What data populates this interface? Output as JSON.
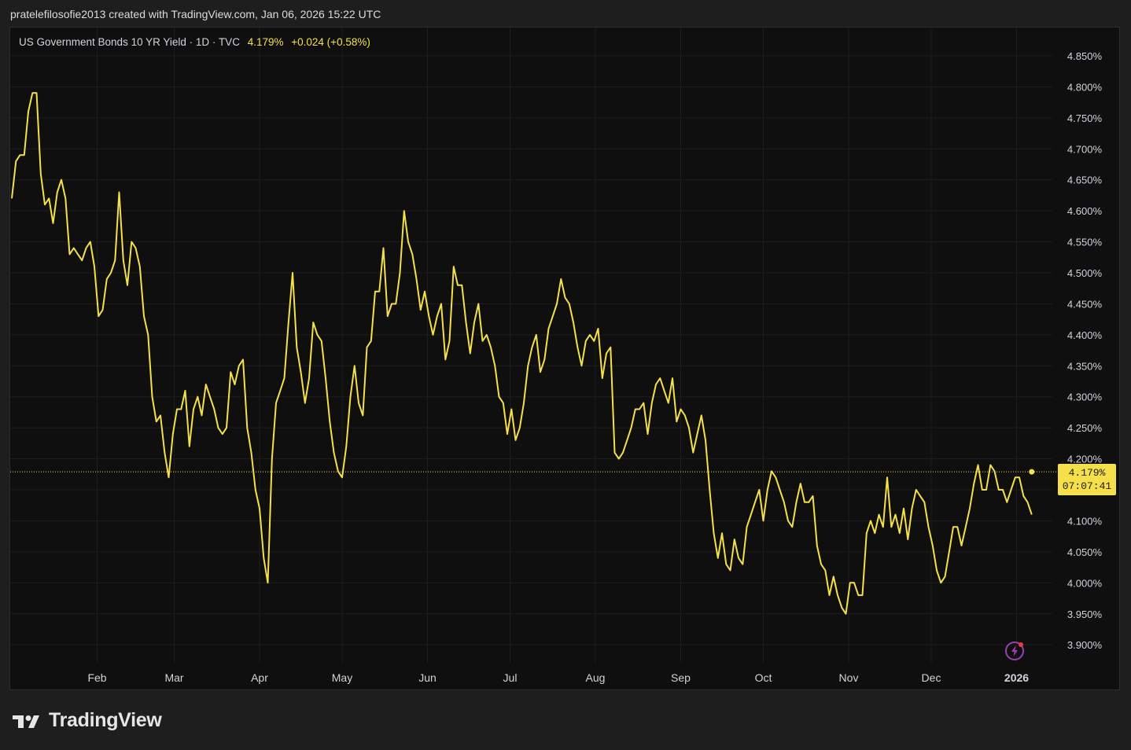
{
  "caption": "pratelefilosofie2013 created with TradingView.com, Jan 06, 2026 15:22 UTC",
  "legend": {
    "name": "US Government Bonds 10 YR Yield",
    "interval": "1D",
    "source": "TVC",
    "last": "4.179%",
    "change": "+0.024 (+0.58%)"
  },
  "price_tag": {
    "value": "4.179%",
    "countdown": "07:07:41"
  },
  "brand": {
    "name": "TradingView"
  },
  "colors": {
    "line": "#f5e049",
    "background": "#0f0f0f",
    "grid": "#1e1e1e",
    "text": "#d1d4dc"
  },
  "icons": [
    "tradingview-logo-icon",
    "bolt-icon"
  ],
  "chart_data": {
    "type": "line",
    "ylim": [
      3.86,
      4.88
    ],
    "yticks": [
      "4.850%",
      "4.800%",
      "4.750%",
      "4.700%",
      "4.650%",
      "4.600%",
      "4.550%",
      "4.500%",
      "4.450%",
      "4.400%",
      "4.350%",
      "4.300%",
      "4.250%",
      "4.200%",
      "4.150%",
      "4.100%",
      "4.050%",
      "4.000%",
      "3.950%",
      "3.900%"
    ],
    "xticks": [
      "Feb",
      "Mar",
      "Apr",
      "May",
      "Jun",
      "Jul",
      "Aug",
      "Sep",
      "Oct",
      "Nov",
      "Dec",
      "2026"
    ],
    "xtick_values": [
      31,
      59,
      90,
      120,
      151,
      181,
      212,
      243,
      273,
      304,
      334,
      365
    ],
    "x_days": [
      0,
      1.5,
      3,
      4.5,
      6,
      7.5,
      9,
      10.5,
      12,
      13.5,
      15,
      16.5,
      18,
      19.5,
      21,
      22.5,
      24,
      25.5,
      27,
      28.5,
      30,
      31.5,
      33,
      34.5,
      36,
      37.5,
      39,
      40.5,
      42,
      43.5,
      45,
      46.5,
      48,
      49.5,
      51,
      52.5,
      54,
      55.5,
      57,
      58.5,
      60,
      61.5,
      63,
      64.5,
      66,
      67.5,
      69,
      70.5,
      72,
      73.5,
      75,
      76.5,
      78,
      79.5,
      81,
      82.5,
      84,
      85.5,
      87,
      88.5,
      90,
      91.5,
      93,
      94.5,
      96,
      97.5,
      99,
      100.5,
      102,
      103.5,
      105,
      106.5,
      108,
      109.5,
      111,
      112.5,
      114,
      115.5,
      117,
      118.5,
      120,
      121.5,
      123,
      124.5,
      126,
      127.5,
      129,
      130.5,
      132,
      133.5,
      135,
      136.5,
      138,
      139.5,
      141,
      142.5,
      144,
      145.5,
      147,
      148.5,
      150,
      151.5,
      153,
      154.5,
      156,
      157.5,
      159,
      160.5,
      162,
      163.5,
      165,
      166.5,
      168,
      169.5,
      171,
      172.5,
      174,
      175.5,
      177,
      178.5,
      180,
      181.5,
      183,
      184.5,
      186,
      187.5,
      189,
      190.5,
      192,
      193.5,
      195,
      196.5,
      198,
      199.5,
      201,
      202.5,
      204,
      205.5,
      207,
      208.5,
      210,
      211.5,
      213,
      214.5,
      216,
      217.5,
      219,
      220.5,
      222,
      223.5,
      225,
      226.5,
      228,
      229.5,
      231,
      232.5,
      234,
      235.5,
      237,
      238.5,
      240,
      241.5,
      243,
      244.5,
      246,
      247.5,
      249,
      250.5,
      252,
      253.5,
      255,
      256.5,
      258,
      259.5,
      261,
      262.5,
      264,
      265.5,
      267,
      268.5,
      270,
      271.5,
      273,
      274.5,
      276,
      277.5,
      279,
      280.5,
      282,
      283.5,
      285,
      286.5,
      288,
      289.5,
      291,
      292.5,
      294,
      295.5,
      297,
      298.5,
      300,
      301.5,
      303,
      304.5,
      306,
      307.5,
      309,
      310.5,
      312,
      313.5,
      315,
      316.5,
      318,
      319.5,
      321,
      322.5,
      324,
      325.5,
      327,
      328.5,
      330,
      331.5,
      333,
      334.5,
      336,
      337.5,
      339,
      340.5,
      342,
      343.5,
      345,
      346.5,
      348,
      349.5,
      351,
      352.5,
      354,
      355.5,
      357,
      358.5,
      360,
      361.5,
      363,
      364.5,
      366,
      367.5,
      369,
      370.5
    ],
    "yield_pct": [
      4.62,
      4.68,
      4.69,
      4.69,
      4.76,
      4.79,
      4.79,
      4.66,
      4.61,
      4.62,
      4.58,
      4.63,
      4.65,
      4.62,
      4.53,
      4.54,
      4.53,
      4.52,
      4.54,
      4.55,
      4.51,
      4.43,
      4.44,
      4.49,
      4.5,
      4.52,
      4.63,
      4.52,
      4.48,
      4.55,
      4.54,
      4.51,
      4.43,
      4.4,
      4.3,
      4.26,
      4.27,
      4.21,
      4.17,
      4.24,
      4.28,
      4.28,
      4.31,
      4.22,
      4.28,
      4.3,
      4.27,
      4.32,
      4.3,
      4.28,
      4.25,
      4.24,
      4.25,
      4.34,
      4.32,
      4.35,
      4.36,
      4.25,
      4.21,
      4.15,
      4.12,
      4.04,
      4.0,
      4.2,
      4.29,
      4.31,
      4.33,
      4.42,
      4.5,
      4.38,
      4.34,
      4.29,
      4.33,
      4.42,
      4.4,
      4.39,
      4.33,
      4.26,
      4.21,
      4.18,
      4.17,
      4.22,
      4.3,
      4.35,
      4.29,
      4.27,
      4.38,
      4.39,
      4.47,
      4.47,
      4.54,
      4.43,
      4.45,
      4.45,
      4.5,
      4.6,
      4.55,
      4.53,
      4.49,
      4.44,
      4.47,
      4.43,
      4.4,
      4.43,
      4.45,
      4.36,
      4.39,
      4.51,
      4.48,
      4.48,
      4.42,
      4.37,
      4.42,
      4.45,
      4.39,
      4.4,
      4.38,
      4.35,
      4.3,
      4.29,
      4.24,
      4.28,
      4.23,
      4.25,
      4.29,
      4.35,
      4.38,
      4.4,
      4.34,
      4.36,
      4.41,
      4.43,
      4.45,
      4.49,
      4.46,
      4.45,
      4.42,
      4.38,
      4.35,
      4.39,
      4.4,
      4.39,
      4.41,
      4.33,
      4.37,
      4.38,
      4.21,
      4.2,
      4.21,
      4.23,
      4.25,
      4.28,
      4.28,
      4.29,
      4.24,
      4.29,
      4.32,
      4.33,
      4.31,
      4.29,
      4.33,
      4.26,
      4.28,
      4.27,
      4.25,
      4.21,
      4.24,
      4.27,
      4.23,
      4.15,
      4.08,
      4.04,
      4.08,
      4.03,
      4.02,
      4.07,
      4.04,
      4.03,
      4.09,
      4.11,
      4.13,
      4.15,
      4.1,
      4.15,
      4.18,
      4.17,
      4.15,
      4.13,
      4.1,
      4.09,
      4.13,
      4.16,
      4.13,
      4.13,
      4.14,
      4.06,
      4.03,
      4.02,
      3.98,
      4.01,
      3.98,
      3.96,
      3.95,
      4.0,
      4.0,
      3.98,
      3.98,
      4.08,
      4.1,
      4.08,
      4.11,
      4.09,
      4.17,
      4.09,
      4.11,
      4.08,
      4.12,
      4.07,
      4.12,
      4.15,
      4.14,
      4.13,
      4.09,
      4.06,
      4.02,
      4.0,
      4.01,
      4.05,
      4.09,
      4.09,
      4.06,
      4.09,
      4.12,
      4.16,
      4.19,
      4.15,
      4.15,
      4.19,
      4.18,
      4.15,
      4.15,
      4.13,
      4.15,
      4.17,
      4.17,
      4.14,
      4.13,
      4.11,
      4.12,
      4.17,
      4.2,
      4.16,
      4.18
    ],
    "last_value": 4.179,
    "grid": true,
    "y_axis_position": "right"
  }
}
